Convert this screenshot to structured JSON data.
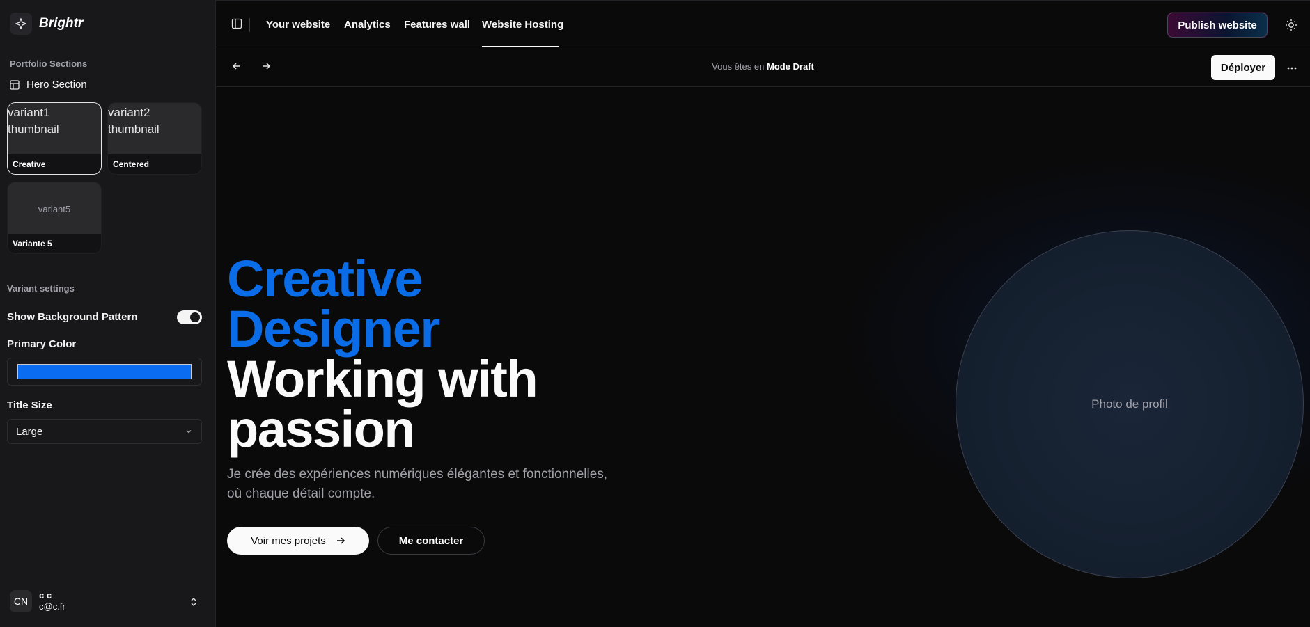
{
  "sidebar": {
    "brand": "Brightr",
    "sections_label": "Portfolio Sections",
    "hero_section": "Hero Section",
    "variants": [
      {
        "thumb_alt": "variant1 thumbnail",
        "label": "Creative",
        "selected": true
      },
      {
        "thumb_alt": "variant2 thumbnail",
        "label": "Centered",
        "selected": false
      },
      {
        "thumb_alt": "variant5",
        "label": "Variante 5",
        "selected": false
      }
    ],
    "variant_settings_label": "Variant settings",
    "show_bg_pattern_label": "Show Background Pattern",
    "show_bg_pattern_on": true,
    "primary_color_label": "Primary Color",
    "primary_color": "#0a6cf0",
    "title_size_label": "Title Size",
    "title_size_value": "Large",
    "user": {
      "initials": "CN",
      "name": "c c",
      "email": "c@c.fr"
    }
  },
  "topbar": {
    "tabs": [
      "Your website",
      "Analytics",
      "Features wall",
      "Website Hosting"
    ],
    "active_tab": "Website Hosting",
    "publish_label": "Publish website"
  },
  "subbar": {
    "draft_prefix": "Vous êtes en",
    "draft_mode": "Mode Draft",
    "deploy_label": "Déployer"
  },
  "hero": {
    "title_line1": "Creative",
    "title_line2": "Designer",
    "title_line3": "Working with",
    "title_line4": "passion",
    "subtitle_line1": "Je crée des expériences numériques élégantes et fonctionnelles,",
    "subtitle_line2": "où chaque détail compte.",
    "primary_button": "Voir mes projets",
    "secondary_button": "Me contacter",
    "profile_photo_label": "Photo de profil"
  },
  "colors": {
    "accent_blue": "#0b6ce8",
    "background": "#0a0a0b",
    "sidebar": "#18181a"
  }
}
